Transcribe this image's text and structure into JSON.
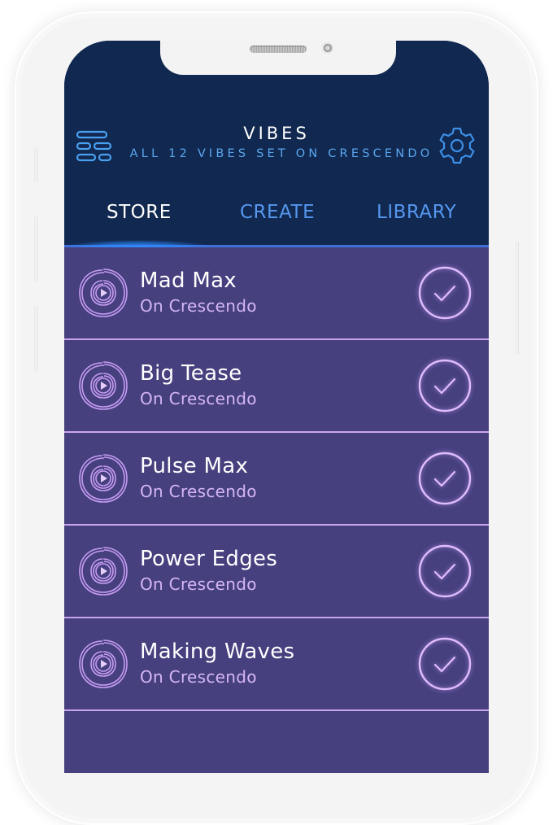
{
  "header": {
    "title": "VIBES",
    "subtitle": "ALL 12 VIBES SET ON CRESCENDO",
    "menu_icon": "menu-icon",
    "settings_icon": "gear-icon"
  },
  "tabs": [
    {
      "label": "STORE",
      "active": true
    },
    {
      "label": "CREATE",
      "active": false
    },
    {
      "label": "LIBRARY",
      "active": false
    }
  ],
  "vibes": [
    {
      "name": "Mad Max",
      "status": "On Crescendo",
      "icon": "vibe-play-icon",
      "selected": true
    },
    {
      "name": "Big Tease",
      "status": "On Crescendo",
      "icon": "vibe-play-icon",
      "selected": true
    },
    {
      "name": "Pulse Max",
      "status": "On Crescendo",
      "icon": "vibe-play-icon",
      "selected": true
    },
    {
      "name": "Power Edges",
      "status": "On Crescendo",
      "icon": "vibe-play-icon",
      "selected": true
    },
    {
      "name": "Making Waves",
      "status": "On Crescendo",
      "icon": "vibe-play-icon",
      "selected": true
    }
  ],
  "colors": {
    "header_bg": "#112850",
    "list_bg": "#46407f",
    "accent_blue": "#5597ee",
    "accent_purple": "#d6b6f4"
  }
}
